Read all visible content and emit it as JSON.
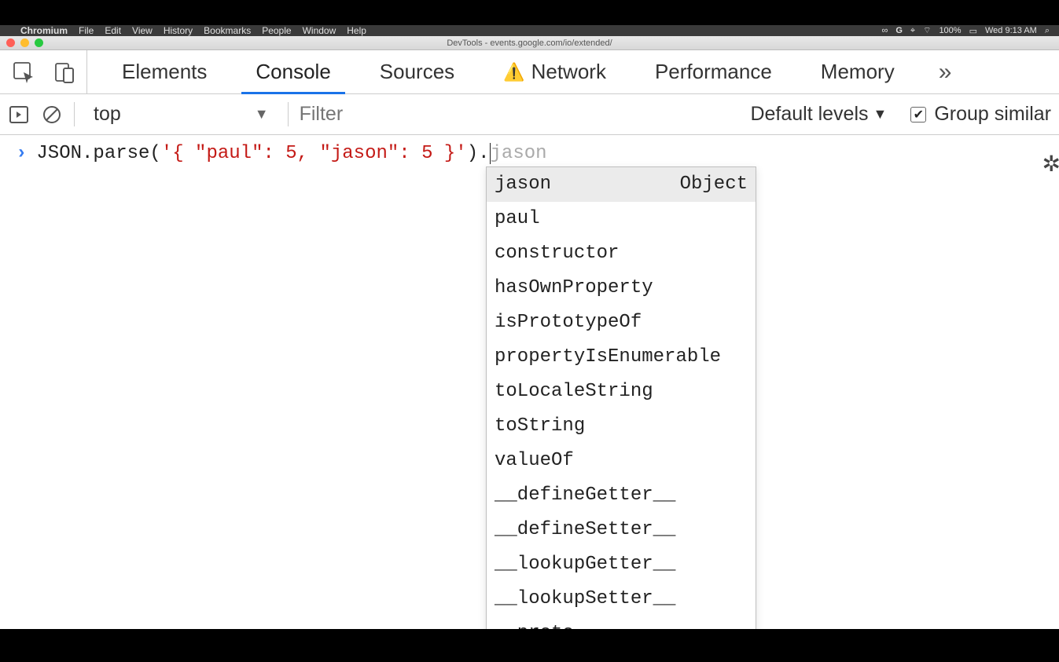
{
  "menubar": {
    "app": "Chromium",
    "items": [
      "File",
      "Edit",
      "View",
      "History",
      "Bookmarks",
      "People",
      "Window",
      "Help"
    ],
    "status": {
      "battery": "100%",
      "clock": "Wed 9:13 AM"
    }
  },
  "window": {
    "title": "DevTools - events.google.com/io/extended/"
  },
  "tabs": {
    "items": [
      "Elements",
      "Console",
      "Sources",
      "Network",
      "Performance",
      "Memory"
    ],
    "active_index": 1,
    "network_has_warning": true
  },
  "toolbar": {
    "context_label": "top",
    "filter_placeholder": "Filter",
    "levels_label": "Default levels",
    "group_similar_label": "Group similar",
    "group_similar_checked": true
  },
  "console": {
    "code_prefix": "JSON.parse(",
    "code_string": "'{ \"paul\": 5, \"jason\": 5 }'",
    "code_suffix": ").",
    "ghost": "jason"
  },
  "autocomplete": {
    "items": [
      {
        "label": "jason",
        "type": "Object",
        "selected": true
      },
      {
        "label": "paul"
      },
      {
        "label": "constructor"
      },
      {
        "label": "hasOwnProperty"
      },
      {
        "label": "isPrototypeOf"
      },
      {
        "label": "propertyIsEnumerable"
      },
      {
        "label": "toLocaleString"
      },
      {
        "label": "toString"
      },
      {
        "label": "valueOf"
      },
      {
        "label": "__defineGetter__"
      },
      {
        "label": "__defineSetter__"
      },
      {
        "label": "__lookupGetter__"
      },
      {
        "label": "__lookupSetter__"
      },
      {
        "label": "__proto__"
      }
    ]
  }
}
